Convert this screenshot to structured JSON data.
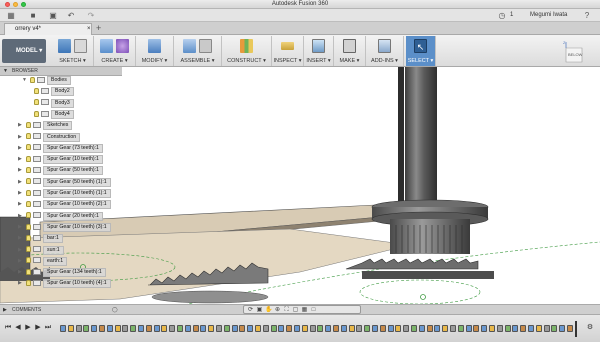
{
  "window": {
    "title": "Autodesk Fusion 360"
  },
  "qat": {
    "user_count": "1",
    "user_name": "Megumi Iwata",
    "help_icon": "help-icon"
  },
  "document": {
    "tab_label": "orrery v4*"
  },
  "toolbar": {
    "model_label": "MODEL",
    "groups": [
      {
        "label": "SKETCH"
      },
      {
        "label": "CREATE"
      },
      {
        "label": "MODIFY"
      },
      {
        "label": "ASSEMBLE"
      },
      {
        "label": "CONSTRUCT"
      },
      {
        "label": "INSPECT"
      },
      {
        "label": "INSERT"
      },
      {
        "label": "MAKE"
      },
      {
        "label": "ADD-INS"
      },
      {
        "label": "SELECT"
      }
    ]
  },
  "browser": {
    "header": "BROWSER",
    "items": [
      {
        "label": "Bodies"
      },
      {
        "label": "Body2"
      },
      {
        "label": "Body3"
      },
      {
        "label": "Body4"
      },
      {
        "label": "Sketches"
      },
      {
        "label": "Construction"
      },
      {
        "label": "Spur Gear (73 teeth):1"
      },
      {
        "label": "Spur Gear (10 teeth):1"
      },
      {
        "label": "Spur Gear (50 teeth):1"
      },
      {
        "label": "Spur Gear (50 teeth) (1):1"
      },
      {
        "label": "Spur Gear (10 teeth) (1):1"
      },
      {
        "label": "Spur Gear (10 teeth) (2):1"
      },
      {
        "label": "Spur Gear (20 teeth):1"
      },
      {
        "label": "Spur Gear (10 teeth) (3):1"
      },
      {
        "label": "bar:1"
      },
      {
        "label": "sun:1"
      },
      {
        "label": "earth:1"
      },
      {
        "label": "Spur Gear (134 teeth):1"
      },
      {
        "label": "Spur Gear (10 teeth) (4):1"
      }
    ]
  },
  "viewcube": {
    "face_label": "BELOW",
    "axis_label": "Z"
  },
  "comments": {
    "label": "COMMENTS"
  },
  "colors": {
    "toolbar_select": "#5b8fc9",
    "model_button": "#5e6a78",
    "gear_metal": "#6d6d6d",
    "base_plate": "#e4d8c2",
    "selection_green": "#3f9a42"
  }
}
